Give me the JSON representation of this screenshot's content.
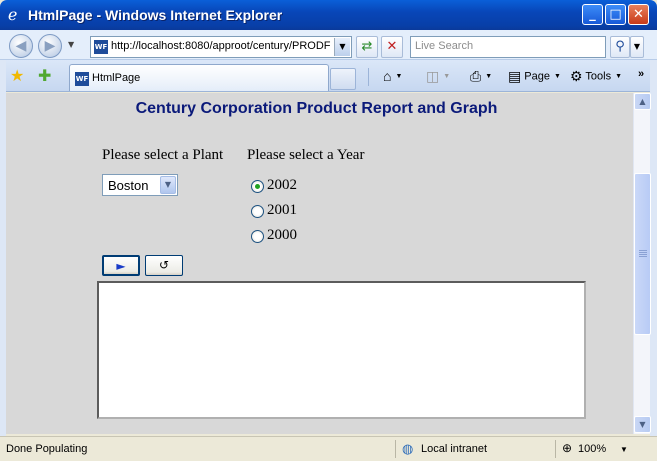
{
  "window": {
    "title": "HtmlPage - Windows Internet Explorer",
    "minimize": "_",
    "maximize": "□",
    "close": "✕"
  },
  "address_bar": {
    "favicon": "WF",
    "url": "http://localhost:8080/approot/century/PRODF",
    "search_placeholder": "Live Search"
  },
  "tab": {
    "favicon": "WF",
    "label": "HtmlPage"
  },
  "commands": {
    "page": "Page",
    "tools": "Tools"
  },
  "report": {
    "title": "Century Corporation Product Report and Graph",
    "plant_label": "Please select a Plant",
    "year_label": "Please select a Year",
    "plant_selected": "Boston",
    "years": [
      "2002",
      "2001",
      "2000"
    ],
    "year_selected": "2002",
    "run_button": "►",
    "reset_button": "↺"
  },
  "status_bar": {
    "text": "Done Populating",
    "zone": "Local intranet",
    "zoom": "100%"
  },
  "colors": {
    "title_text": "#0b1a7a",
    "content_bg": "#d8d8d8"
  }
}
